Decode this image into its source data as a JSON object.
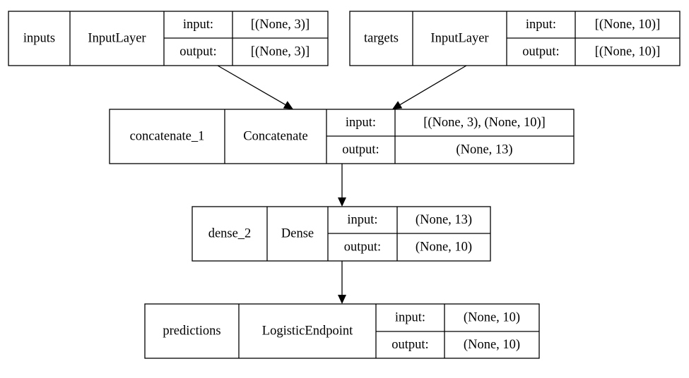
{
  "nodes": [
    {
      "id": "inputs",
      "name": "inputs",
      "type": "InputLayer",
      "input_label": "input:",
      "input": "[(None, 3)]",
      "output_label": "output:",
      "output": "[(None, 3)]"
    },
    {
      "id": "targets",
      "name": "targets",
      "type": "InputLayer",
      "input_label": "input:",
      "input": "[(None, 10)]",
      "output_label": "output:",
      "output": "[(None, 10)]"
    },
    {
      "id": "concatenate_1",
      "name": "concatenate_1",
      "type": "Concatenate",
      "input_label": "input:",
      "input": "[(None, 3), (None, 10)]",
      "output_label": "output:",
      "output": "(None, 13)"
    },
    {
      "id": "dense_2",
      "name": "dense_2",
      "type": "Dense",
      "input_label": "input:",
      "input": "(None, 13)",
      "output_label": "output:",
      "output": "(None, 10)"
    },
    {
      "id": "predictions",
      "name": "predictions",
      "type": "LogisticEndpoint",
      "input_label": "input:",
      "input": "(None, 10)",
      "output_label": "output:",
      "output": "(None, 10)"
    }
  ],
  "edges": [
    {
      "from": "inputs",
      "to": "concatenate_1"
    },
    {
      "from": "targets",
      "to": "concatenate_1"
    },
    {
      "from": "concatenate_1",
      "to": "dense_2"
    },
    {
      "from": "dense_2",
      "to": "predictions"
    }
  ],
  "colors": {
    "stroke": "#000000",
    "background": "#ffffff"
  }
}
